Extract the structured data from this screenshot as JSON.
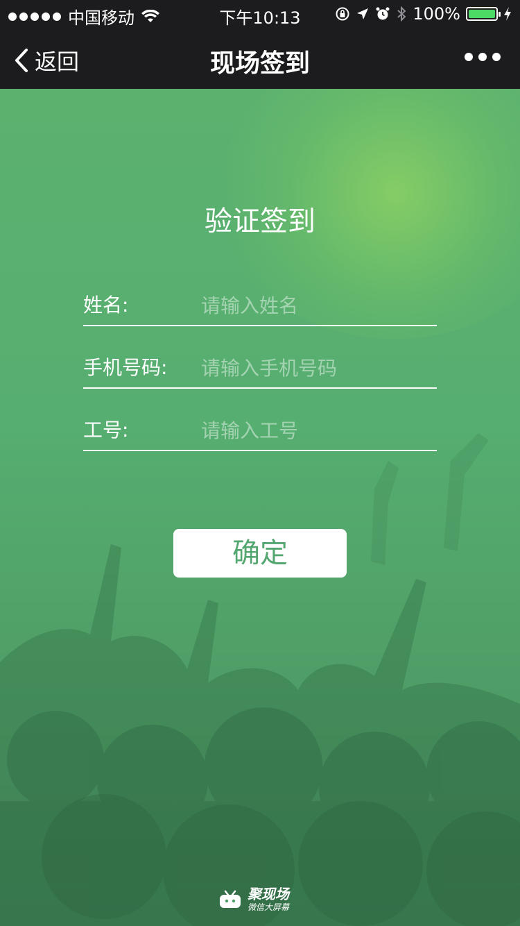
{
  "status_bar": {
    "carrier": "中国移动",
    "time": "下午10:13",
    "battery_percent": "100%",
    "battery_level": 1.0
  },
  "nav": {
    "back_label": "返回",
    "title": "现场签到"
  },
  "form": {
    "title": "验证签到",
    "fields": [
      {
        "label": "姓名:",
        "placeholder": "请输入姓名",
        "value": ""
      },
      {
        "label": "手机号码:",
        "placeholder": "请输入手机号码",
        "value": ""
      },
      {
        "label": "工号:",
        "placeholder": "请输入工号",
        "value": ""
      }
    ],
    "submit_label": "确定"
  },
  "brand": {
    "name": "聚现场",
    "subtitle": "微信大屏幕"
  },
  "colors": {
    "accent_green": "#54a770",
    "bar_dark": "#1c1c1e",
    "battery_green": "#4cd964"
  }
}
